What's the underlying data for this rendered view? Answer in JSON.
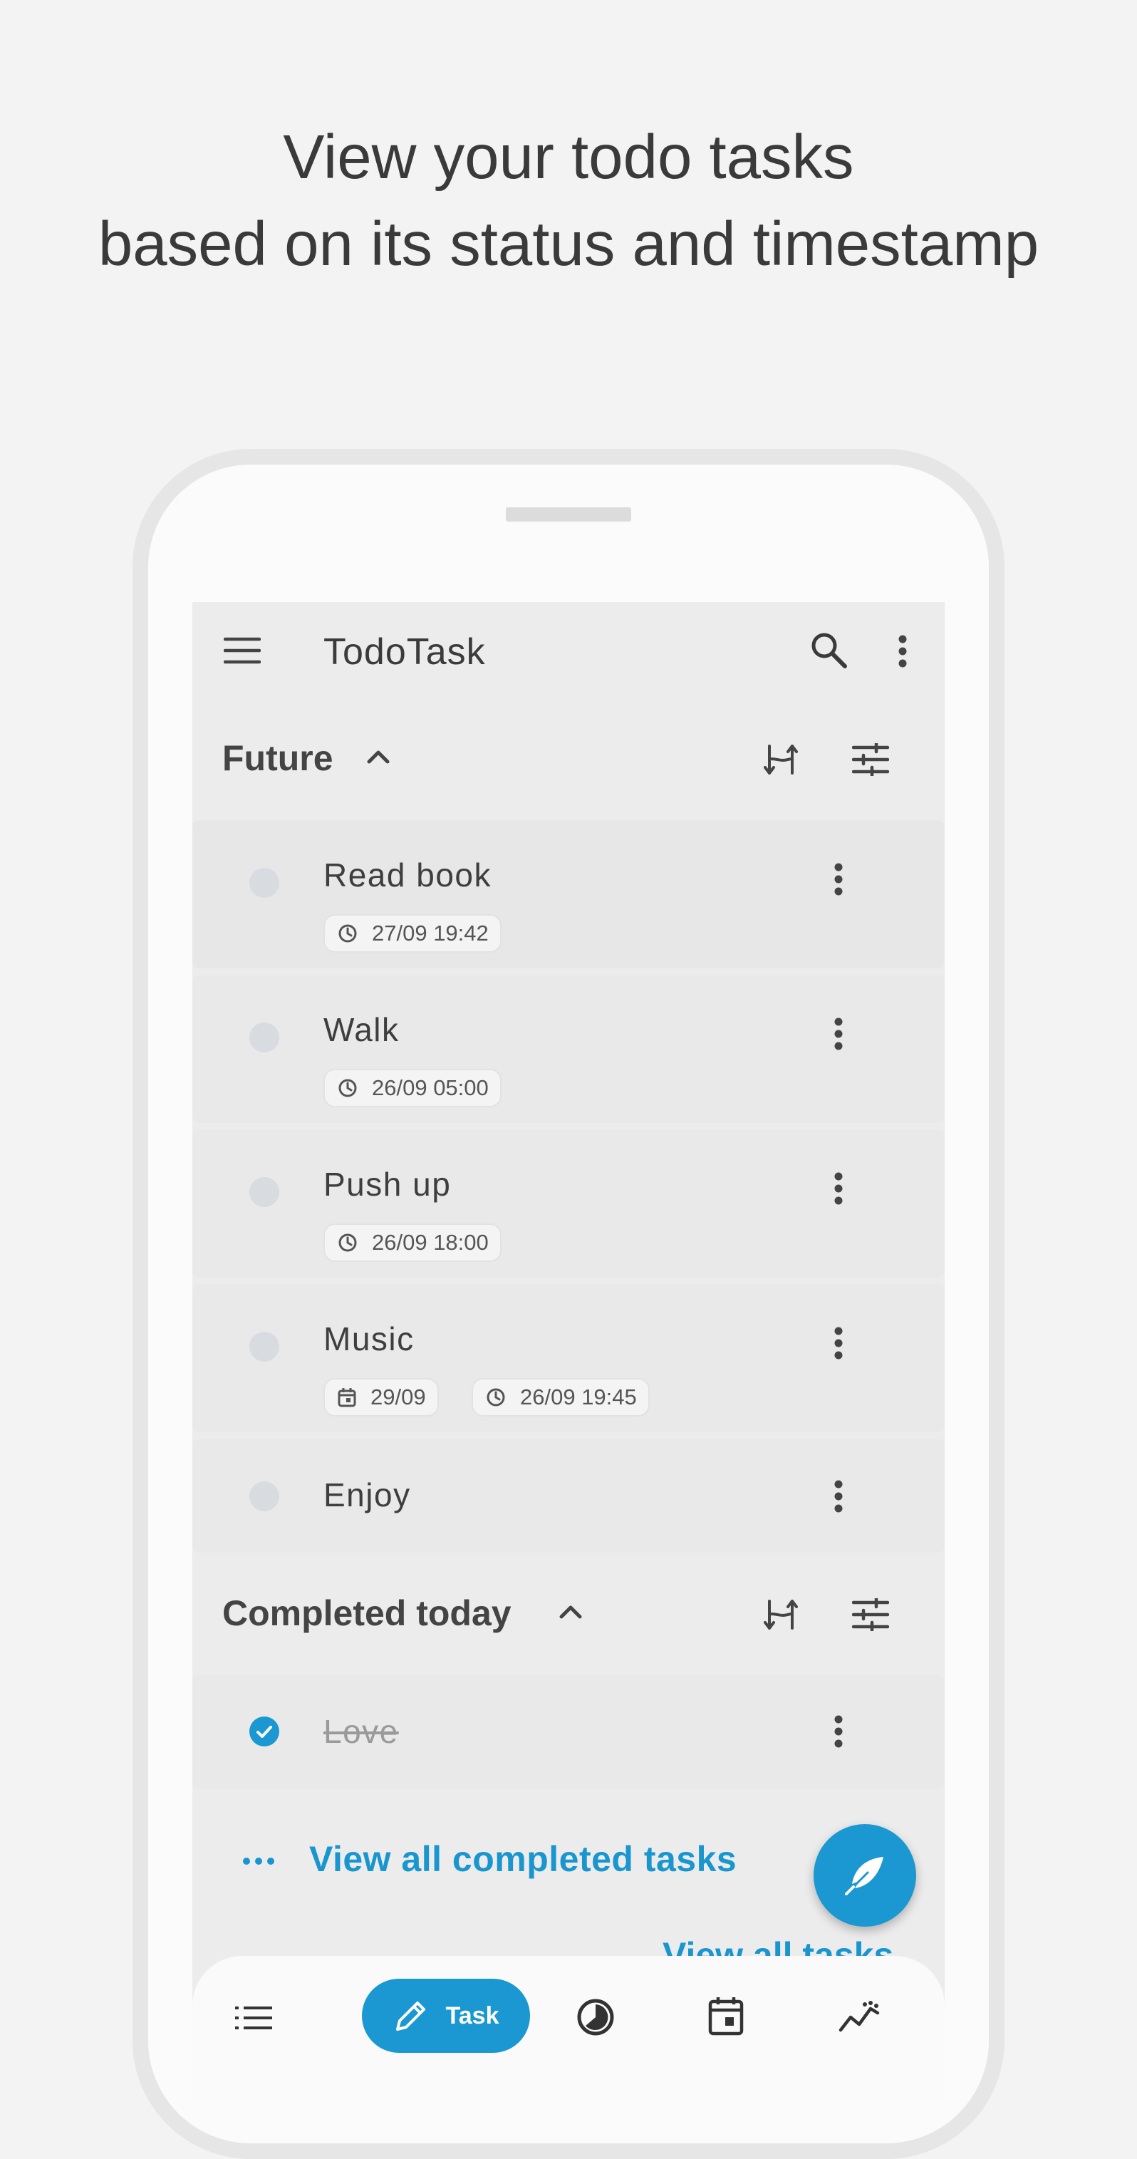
{
  "headline": {
    "line1": "View your todo tasks",
    "line2": "based on its status and timestamp"
  },
  "app": {
    "title": "TodoTask"
  },
  "sections": {
    "future": {
      "title": "Future"
    },
    "completed": {
      "title": "Completed today"
    }
  },
  "tasks": [
    {
      "title": "Read book",
      "time": "27/09 19:42"
    },
    {
      "title": "Walk",
      "time": "26/09 05:00"
    },
    {
      "title": "Push up",
      "time": "26/09 18:00"
    },
    {
      "title": "Music",
      "date": "29/09",
      "time": "26/09 19:45"
    },
    {
      "title": "Enjoy"
    }
  ],
  "completed_tasks": [
    {
      "title": "Love",
      "done": true
    }
  ],
  "links": {
    "view_all_completed": "View all completed tasks",
    "view_all_partial": "View all tasks"
  },
  "bottom_nav": {
    "task_label": "Task"
  },
  "colors": {
    "accent": "#1b98d1",
    "background": "#f3f3f3",
    "screen": "#ececec"
  },
  "icons": [
    "menu-icon",
    "search-icon",
    "more-vert-icon",
    "chevron-up-icon",
    "sort-icon",
    "filter-icon",
    "clock-icon",
    "calendar-icon",
    "feather-icon",
    "list-icon",
    "pencil-icon",
    "pie-icon",
    "calendar-day-icon",
    "chart-icon",
    "check-icon"
  ]
}
